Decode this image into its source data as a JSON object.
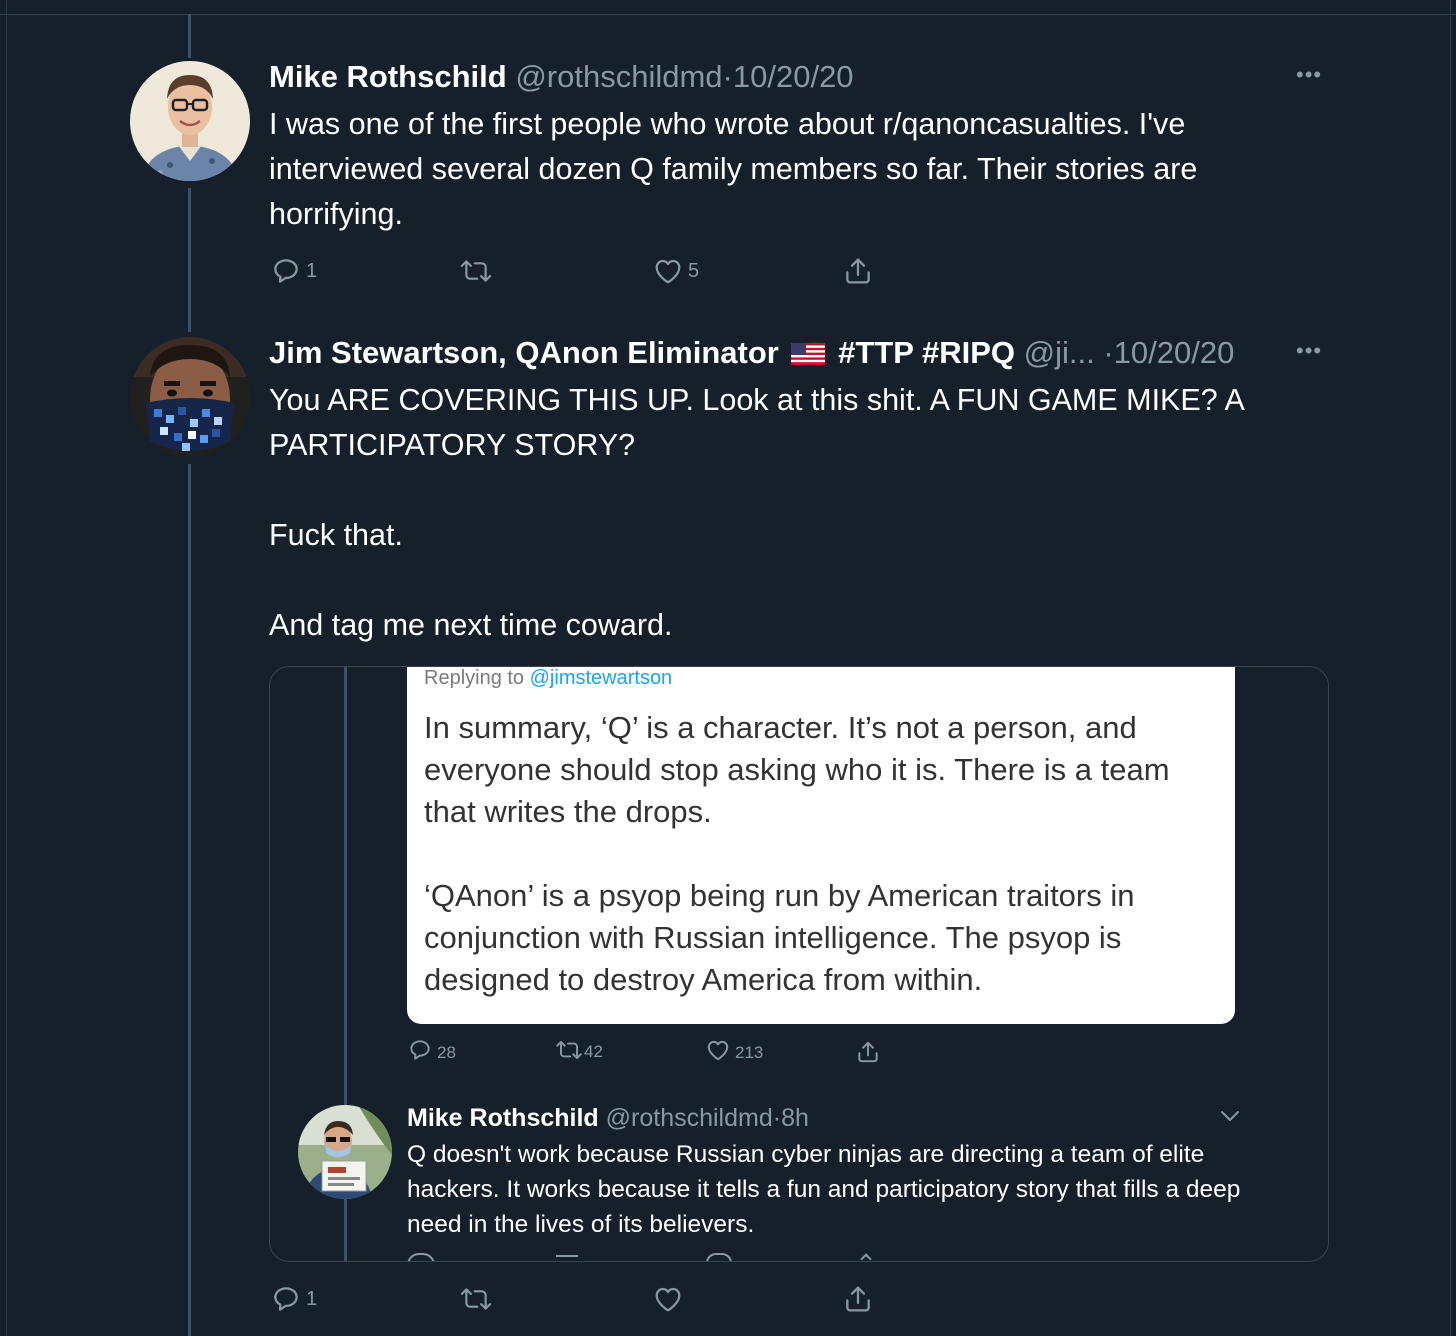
{
  "tweet1": {
    "name": "Mike Rothschild",
    "handle": "@rothschildmd",
    "separator": "·",
    "date": "10/20/20",
    "more": "•••",
    "text": "I was one of the first people who wrote about r/qanoncasualties. I've interviewed several dozen Q family members so far. Their stories are horrifying.",
    "replies": "1",
    "retweets": "",
    "likes": "5"
  },
  "tweet2": {
    "name": "Jim Stewartson, QAnon Eliminator",
    "flag": "🇺🇸",
    "hashtags": "#TTP #RIPQ",
    "handle": "@ji...",
    "separator": "·",
    "date": "10/20/20",
    "more": "•••",
    "text": "You ARE COVERING THIS UP. Look at this shit. A FUN GAME MIKE? A PARTICIPATORY STORY?\n\nFuck that.\n\nAnd tag me next time coward.",
    "replies": "1",
    "retweets": "",
    "likes": ""
  },
  "embedded": {
    "screenshot": {
      "replying_to_label": "Replying to",
      "replying_to_handle": "@jimstewartson",
      "text": "In summary, ‘Q’ is a character. It’s not a person, and everyone should stop asking who it is. There is a team that writes the drops.\n\n‘QAnon’ is a psyop being run by American traitors in conjunction with Russian intelligence. The psyop is designed to destroy America from within."
    },
    "stats": {
      "replies": "28",
      "retweets": "42",
      "likes": "213"
    },
    "reply": {
      "name": "Mike Rothschild",
      "handle": "@rothschildmd",
      "separator": "·",
      "time": "8h",
      "text": "Q doesn't work because Russian cyber ninjas are directing a team of elite hackers. It works because it tells a fun and participatory story that fills a deep need in the lives of its believers."
    }
  },
  "colors": {
    "background": "#15202b",
    "secondary_text": "#8899a6",
    "border": "#38444d",
    "link": "#1da1f2"
  }
}
